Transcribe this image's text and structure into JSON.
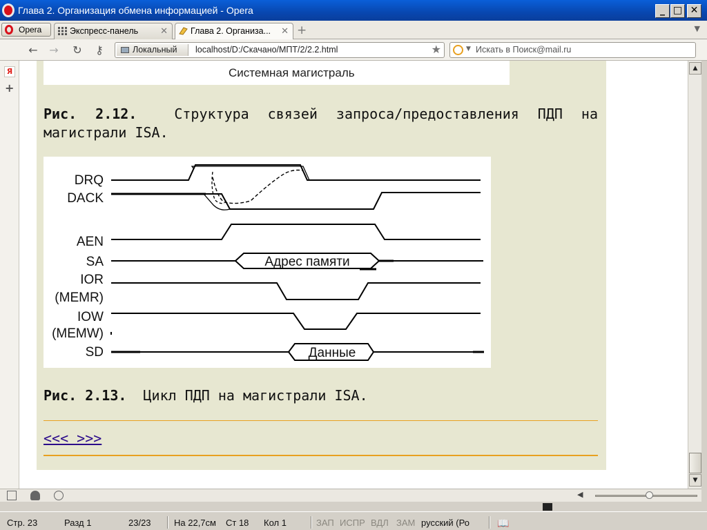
{
  "window": {
    "title": "Глава 2. Организация обмена информацией - Opera"
  },
  "tabs": {
    "menu_label": "Opera",
    "items": [
      {
        "label": "Экспресс-панель"
      },
      {
        "label": "Глава 2. Организа..."
      }
    ]
  },
  "address": {
    "security_label": "Локальный",
    "url": "localhost/D:/Скачано/МПТ/2/2.2.html",
    "search_placeholder": "Искать в Поиск@mail.ru"
  },
  "page": {
    "figure12_bottom_label": "Системная магистраль",
    "caption12_num": "Рис. 2.12.",
    "caption12_text": "Структура связей запроса/предоставления ПДП на магистрали ISA.",
    "caption13_num": "Рис. 2.13.",
    "caption13_text": "Цикл ПДП на магистрали ISA.",
    "nav_links": "<<< >>>",
    "timing_diagram": {
      "signals": [
        "DRQ",
        "DACK",
        "AEN",
        "SA",
        "IOR",
        "(MEMR)",
        "IOW",
        "(MEMW)",
        "SD"
      ],
      "address_label": "Адрес памяти",
      "data_label": "Данные"
    }
  },
  "word_status": {
    "page": "Стр. 23",
    "section": "Разд 1",
    "pages": "23/23",
    "position": "На 22,7см",
    "line": "Ст 18",
    "column": "Кол 1",
    "rec": "ЗАП",
    "trk": "ИСПР",
    "ext": "ВДЛ",
    "ovr": "ЗАМ",
    "language": "русский (Ро"
  }
}
